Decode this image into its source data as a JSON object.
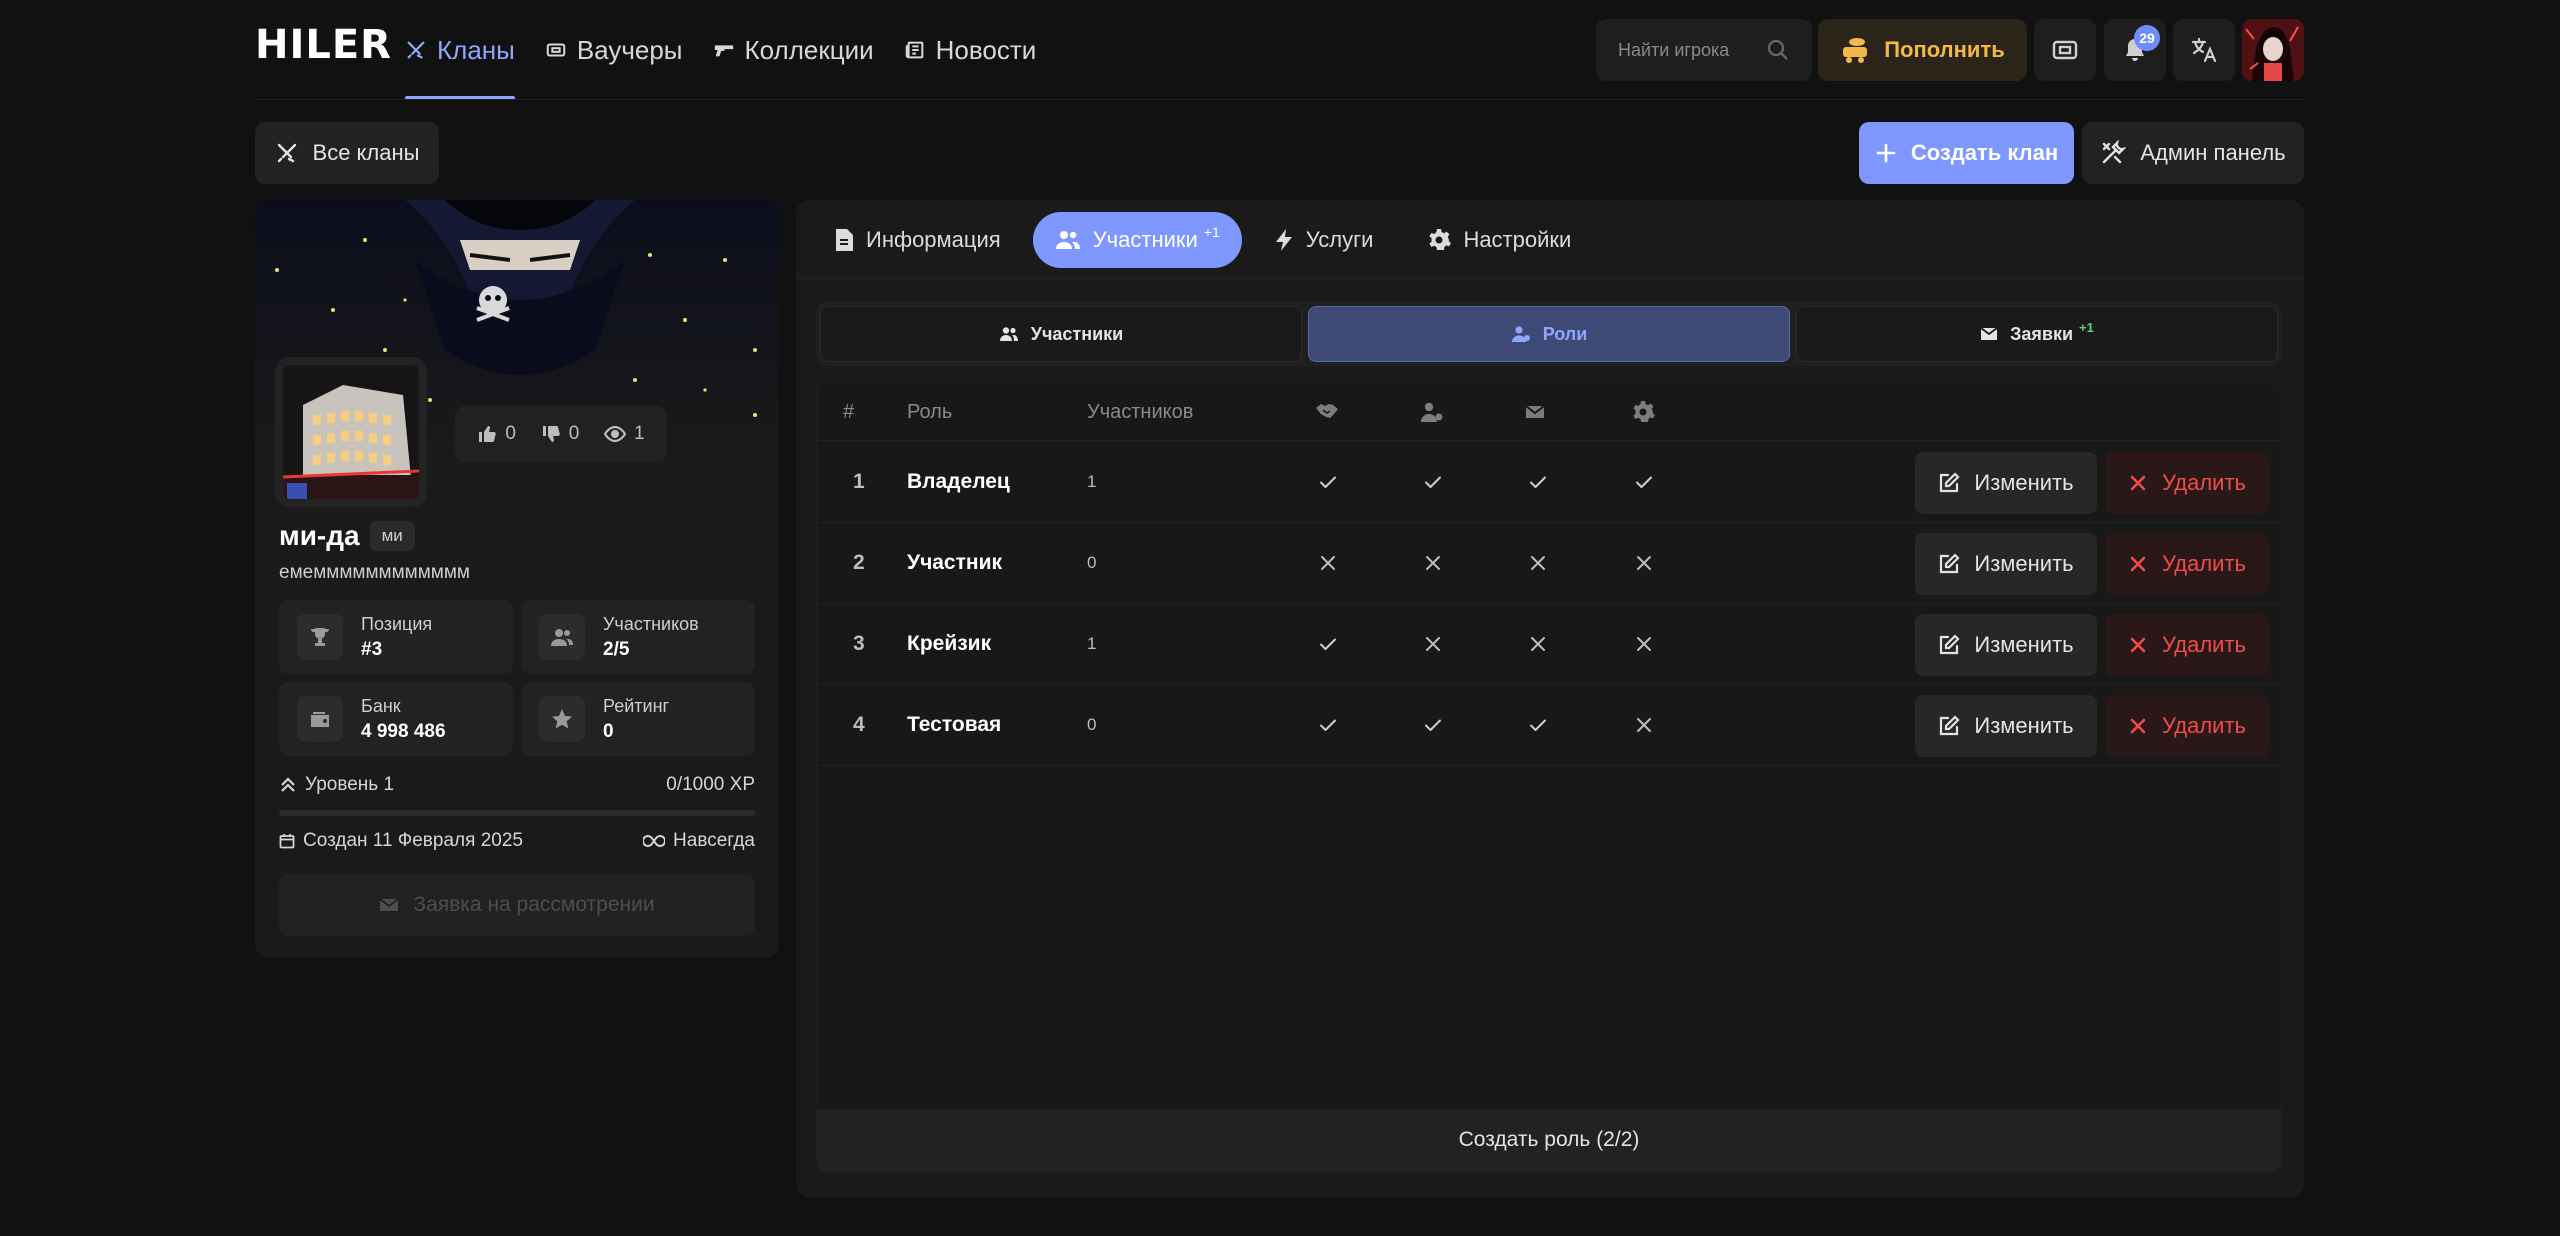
{
  "header": {
    "logo": "HILER",
    "nav": [
      {
        "label": "Кланы",
        "icon": "swords-icon",
        "active": true
      },
      {
        "label": "Ваучеры",
        "icon": "ticket-icon",
        "active": false
      },
      {
        "label": "Коллекции",
        "icon": "gun-icon",
        "active": false
      },
      {
        "label": "Новости",
        "icon": "newspaper-icon",
        "active": false
      }
    ],
    "search_placeholder": "Найти игрока",
    "topup_label": "Пополнить",
    "notifications_count": "29"
  },
  "actions": {
    "all_clans": "Все кланы",
    "create_clan": "Создать клан",
    "admin_panel": "Админ панель"
  },
  "clan": {
    "name": "ми-да",
    "tag": "ми",
    "description": "емемммммммммммм",
    "likes": "0",
    "dislikes": "0",
    "views": "1",
    "stats": [
      {
        "label": "Позиция",
        "value": "#3",
        "icon": "trophy-icon"
      },
      {
        "label": "Участников",
        "value": "2/5",
        "icon": "users-icon"
      },
      {
        "label": "Банк",
        "value": "4 998 486",
        "icon": "wallet-icon"
      },
      {
        "label": "Рейтинг",
        "value": "0",
        "icon": "star-icon"
      }
    ],
    "level": "Уровень 1",
    "xp": "0/1000 XP",
    "xp_progress": 0,
    "created": "Создан 11 Февраля 2025",
    "duration": "Навсегда",
    "request_label": "Заявка на рассмотрении"
  },
  "tabs": [
    {
      "label": "Информация",
      "icon": "document-icon",
      "active": false,
      "sup": ""
    },
    {
      "label": "Участники",
      "icon": "users-icon",
      "active": true,
      "sup": "+1"
    },
    {
      "label": "Услуги",
      "icon": "bolt-icon",
      "active": false,
      "sup": ""
    },
    {
      "label": "Настройки",
      "icon": "gear-icon",
      "active": false,
      "sup": ""
    }
  ],
  "subtabs": [
    {
      "label": "Участники",
      "active": false,
      "sup": ""
    },
    {
      "label": "Роли",
      "active": true,
      "sup": ""
    },
    {
      "label": "Заявки",
      "active": false,
      "sup": "+1"
    }
  ],
  "table": {
    "headers": {
      "num": "#",
      "role": "Роль",
      "count": "Участников"
    },
    "perm_icons": [
      "handshake-icon",
      "user-plus-icon",
      "envelope-icon",
      "gear-icon"
    ],
    "rows": [
      {
        "num": "1",
        "role": "Владелец",
        "count": "1",
        "perms": [
          true,
          true,
          true,
          true
        ]
      },
      {
        "num": "2",
        "role": "Участник",
        "count": "0",
        "perms": [
          false,
          false,
          false,
          false
        ]
      },
      {
        "num": "3",
        "role": "Крейзик",
        "count": "1",
        "perms": [
          true,
          false,
          false,
          false
        ]
      },
      {
        "num": "4",
        "role": "Тестовая",
        "count": "0",
        "perms": [
          true,
          true,
          true,
          false
        ]
      }
    ],
    "edit_label": "Изменить",
    "delete_label": "Удалить",
    "create_role": "Создать роль (2/2)"
  },
  "colors": {
    "accent": "#7f98ff",
    "danger": "#f14c4c",
    "gold": "#f1b84a",
    "success": "#5fd37b"
  }
}
